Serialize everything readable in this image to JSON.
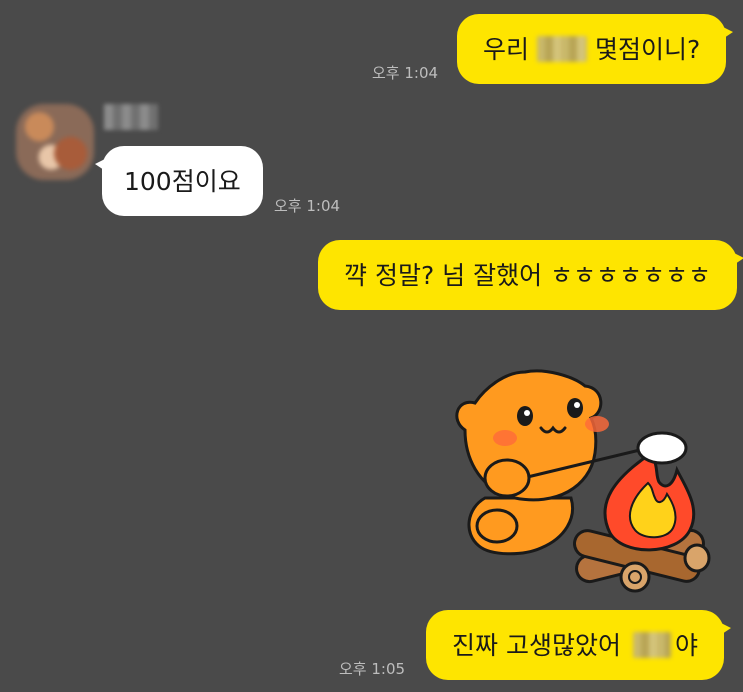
{
  "messages": [
    {
      "side": "mine",
      "before": "우리",
      "after": "몇점이니?",
      "time": "오후 1:04"
    },
    {
      "side": "theirs",
      "text": "100점이요",
      "time": "오후 1:04"
    },
    {
      "side": "mine",
      "text": "꺅 정말? 넘 잘했어 ㅎㅎㅎㅎㅎㅎㅎ"
    },
    {
      "side": "mine",
      "type": "sticker",
      "sticker": "bear-roasting-marshmallow-sticker"
    },
    {
      "side": "mine",
      "before": "진짜 고생많았어",
      "after": "야",
      "time": "오후 1:05"
    }
  ],
  "colors": {
    "background": "#4a4a4a",
    "mine_bubble": "#fee500",
    "theirs_bubble": "#ffffff",
    "time_text": "#bdbdbd"
  }
}
